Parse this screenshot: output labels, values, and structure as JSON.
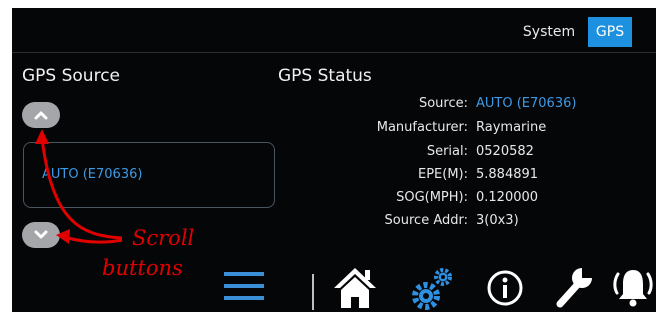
{
  "header": {
    "tabs": [
      {
        "label": "System",
        "active": false
      },
      {
        "label": "GPS",
        "active": true
      }
    ]
  },
  "gps_source": {
    "title": "GPS Source",
    "selected": "AUTO (E70636)"
  },
  "gps_status": {
    "title": "GPS Status",
    "rows": [
      {
        "label": "Source:",
        "value": "AUTO (E70636)"
      },
      {
        "label": "Manufacturer:",
        "value": "Raymarine"
      },
      {
        "label": "Serial:",
        "value": "0520582"
      },
      {
        "label": "EPE(M):",
        "value": "5.884891"
      },
      {
        "label": "SOG(MPH):",
        "value": "0.120000"
      },
      {
        "label": "Source Addr:",
        "value": "3(0x3)"
      }
    ]
  },
  "annotation": {
    "line1": "Scroll",
    "line2": "buttons"
  },
  "nav": {
    "icons": [
      "menu-icon",
      "home-icon",
      "settings-gears-icon",
      "info-icon",
      "wrench-icon",
      "alarm-bell-icon"
    ]
  },
  "colors": {
    "accent": "#1e90e0",
    "value_accent": "#3d9ae6",
    "background": "#050608",
    "annotation": "#e00000"
  }
}
